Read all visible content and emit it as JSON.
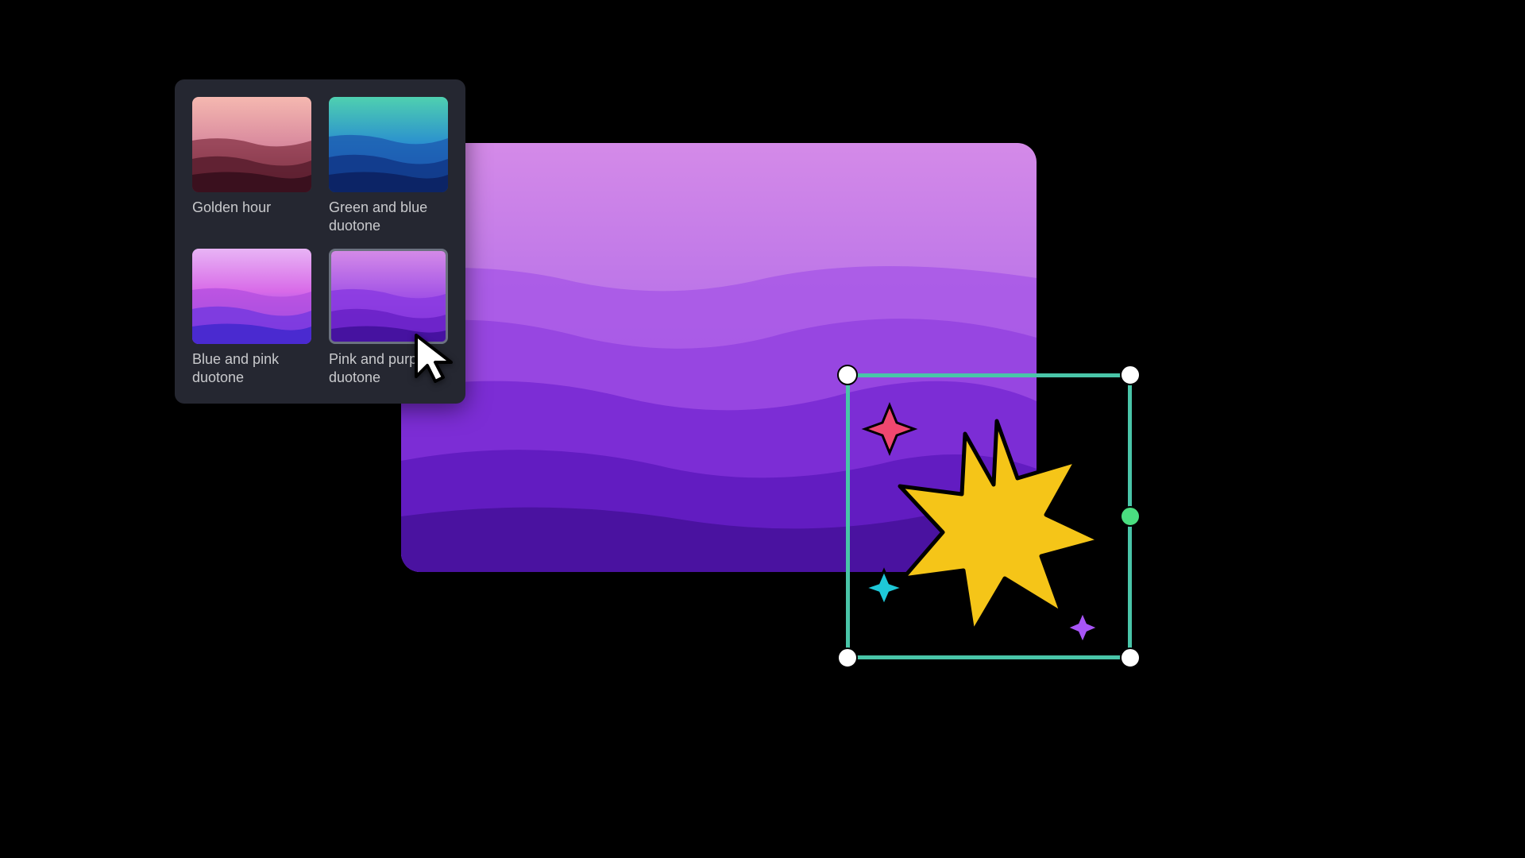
{
  "filter_panel": {
    "options": [
      {
        "label": "Golden hour",
        "selected": false
      },
      {
        "label": "Green and blue duotone",
        "selected": false
      },
      {
        "label": "Blue and pink duotone",
        "selected": false
      },
      {
        "label": "Pink and purple duotone",
        "selected": true
      }
    ]
  },
  "colors": {
    "selection_border": "#49c5a8",
    "rotate_handle": "#4ade80",
    "star_yellow": "#f5c518",
    "sparkle_red": "#f04770",
    "sparkle_cyan": "#1ec8d8",
    "sparkle_purple": "#a855f7",
    "panel_bg": "#252731",
    "label_text": "#c8c9cc"
  }
}
